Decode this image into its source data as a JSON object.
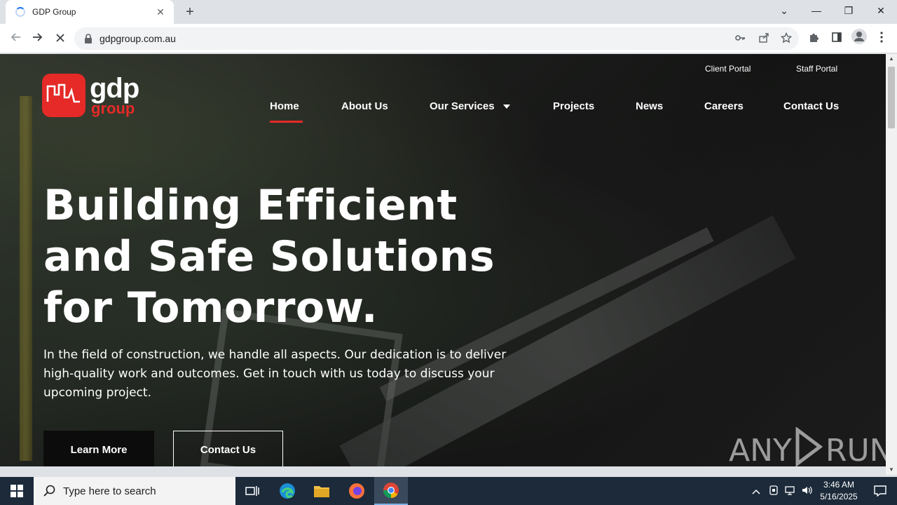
{
  "browser": {
    "tab_title": "GDP Group",
    "new_tab": "+",
    "url": "gdpgroup.com.au",
    "window_controls": {
      "minimize": "—",
      "restore": "❐",
      "close": "✕",
      "tab_search": "⌄"
    }
  },
  "site": {
    "logo": {
      "line1": "gdp",
      "line2": "group"
    },
    "portals": {
      "client": "Client Portal",
      "staff": "Staff Portal"
    },
    "nav": {
      "home": "Home",
      "about": "About Us",
      "services": "Our Services",
      "projects": "Projects",
      "news": "News",
      "careers": "Careers",
      "contact": "Contact Us"
    },
    "hero": {
      "title_line1": "Building Efficient",
      "title_line2": "and Safe Solutions",
      "title_line3": "for Tomorrow.",
      "text_line1": "In the field of construction, we handle all aspects. Our dedication is to deliver",
      "text_line2": "high-quality work and outcomes. Get in touch with us today to discuss your",
      "text_line3": "upcoming project."
    },
    "buttons": {
      "learn_more": "Learn More",
      "contact_us": "Contact Us"
    },
    "accent_color": "#e52a27"
  },
  "watermark": {
    "left": "ANY",
    "right": "RUN"
  },
  "taskbar": {
    "search_placeholder": "Type here to search",
    "time": "3:46 AM",
    "date": "5/16/2025"
  }
}
